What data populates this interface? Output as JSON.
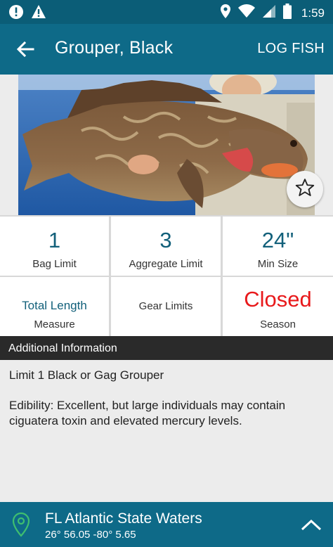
{
  "status_bar": {
    "time": "1:59",
    "left_icons": [
      "alert-circle-icon",
      "warning-triangle-icon"
    ],
    "right_icons": [
      "location-icon",
      "wifi-icon",
      "signal-icon",
      "battery-icon"
    ]
  },
  "app_bar": {
    "title": "Grouper, Black",
    "action_label": "LOG FISH",
    "back_icon": "arrow-back-icon"
  },
  "hero": {
    "favorite_icon": "star-outline-icon"
  },
  "regulations": {
    "bag_limit": {
      "value": "1",
      "label": "Bag Limit"
    },
    "aggregate_limit": {
      "value": "3",
      "label": "Aggregate Limit"
    },
    "min_size": {
      "value": "24\"",
      "label": "Min Size"
    },
    "measure": {
      "value": "Total Length",
      "label": "Measure"
    },
    "gear_limits": {
      "label": "Gear Limits"
    },
    "season": {
      "value": "Closed",
      "label": "Season"
    }
  },
  "additional_info": {
    "header": "Additional Information",
    "lines": [
      "Limit 1 Black or Gag Grouper",
      "Edibility: Excellent, but large individuals may contain ciguatera toxin and elevated mercury levels."
    ]
  },
  "location": {
    "name": "FL Atlantic State Waters",
    "coords": "26° 56.05  -80° 5.65",
    "icon": "map-pin-icon",
    "expand_icon": "chevron-up-icon"
  },
  "colors": {
    "primary": "#0e6a88",
    "status_bar": "#0b5d77",
    "value_text": "#12607a",
    "closed_red": "#e8191b"
  }
}
